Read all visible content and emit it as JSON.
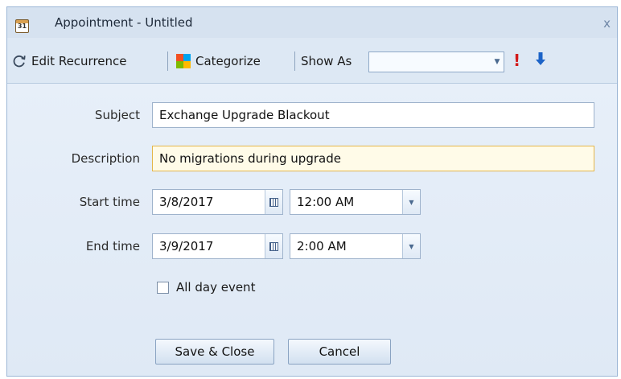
{
  "window": {
    "title": "Appointment - Untitled",
    "icon_text": "31",
    "close_label": "x"
  },
  "toolbar": {
    "recurrence_label": "Edit Recurrence",
    "categorize_label": "Categorize",
    "showas_label": "Show As",
    "showas_value": "",
    "high_priority_glyph": "!",
    "low_priority_glyph": "🡇"
  },
  "form": {
    "subject_label": "Subject",
    "subject_value": "Exchange Upgrade Blackout",
    "description_label": "Description",
    "description_value": "No migrations during upgrade",
    "start_label": "Start time",
    "start_date": "3/8/2017",
    "start_time": "12:00 AM",
    "end_label": "End time",
    "end_date": "3/9/2017",
    "end_time": "2:00 AM",
    "allday_label": "All day event",
    "allday_checked": false
  },
  "buttons": {
    "save_label": "Save & Close",
    "cancel_label": "Cancel"
  },
  "colors": {
    "dialog_bg": "#dde8f4",
    "description_border": "#e4b64a",
    "priority_high": "#d21a1a",
    "priority_low": "#1c63c7",
    "categorize_icon": [
      "#f25022",
      "#7fba00",
      "#00a4ef",
      "#ffb900"
    ]
  }
}
